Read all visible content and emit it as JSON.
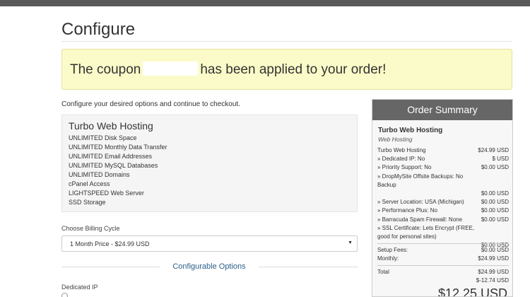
{
  "page": {
    "title": "Configure"
  },
  "coupon": {
    "before": "The coupon",
    "after": "has been applied to your order!"
  },
  "intro": "Configure your desired options and continue to checkout.",
  "product": {
    "name": "Turbo Web Hosting",
    "features": [
      "UNLIMITED Disk Space",
      "UNLIMITED Monthly Data Transfer",
      "UNLIMITED Email Addresses",
      "UNLIMITED MySQL Databases",
      "UNLIMITED Domains",
      "cPanel Access",
      "LIGHTSPEED Web Server",
      "SSD Storage"
    ]
  },
  "billing": {
    "label": "Choose Billing Cycle",
    "selected": "1 Month Price - $24.99 USD"
  },
  "configurable": {
    "title": "Configurable Options",
    "dedicated_ip_label": "Dedicated IP"
  },
  "summary": {
    "title": "Order Summary",
    "product_name": "Turbo Web Hosting",
    "product_group": "Web Hosting",
    "lines": [
      {
        "label": "Turbo Web Hosting",
        "amount": "$24.99 USD"
      },
      {
        "label": "» Dedicated IP: No",
        "amount": "$ USD"
      },
      {
        "label": "» Priority Support: No",
        "amount": "$0.00 USD"
      },
      {
        "label": "» DropMySite Offsite Backups: No Backup",
        "amount": ""
      },
      {
        "label": "",
        "amount": "$0.00 USD"
      },
      {
        "label": "» Server Location: USA (Michigan)",
        "amount": "$0.00 USD"
      },
      {
        "label": "» Performance Plus: No",
        "amount": "$0.00 USD"
      },
      {
        "label": "» Barracuda Spam Firewall: None",
        "amount": "$0.00 USD"
      },
      {
        "label": "» SSL Certificate: Lets Encrypt (FREE, good for personal sites)",
        "amount": ""
      },
      {
        "label": "",
        "amount": "$0.00 USD"
      }
    ],
    "setup_fees_label": "Setup Fees:",
    "setup_fees": "$0.00 USD",
    "monthly_label": "Monthly:",
    "monthly": "$24.99 USD",
    "total_label": "Total",
    "total": "$24.99 USD",
    "discount": "$-12.74 USD",
    "due_today": "$12.25 USD"
  }
}
